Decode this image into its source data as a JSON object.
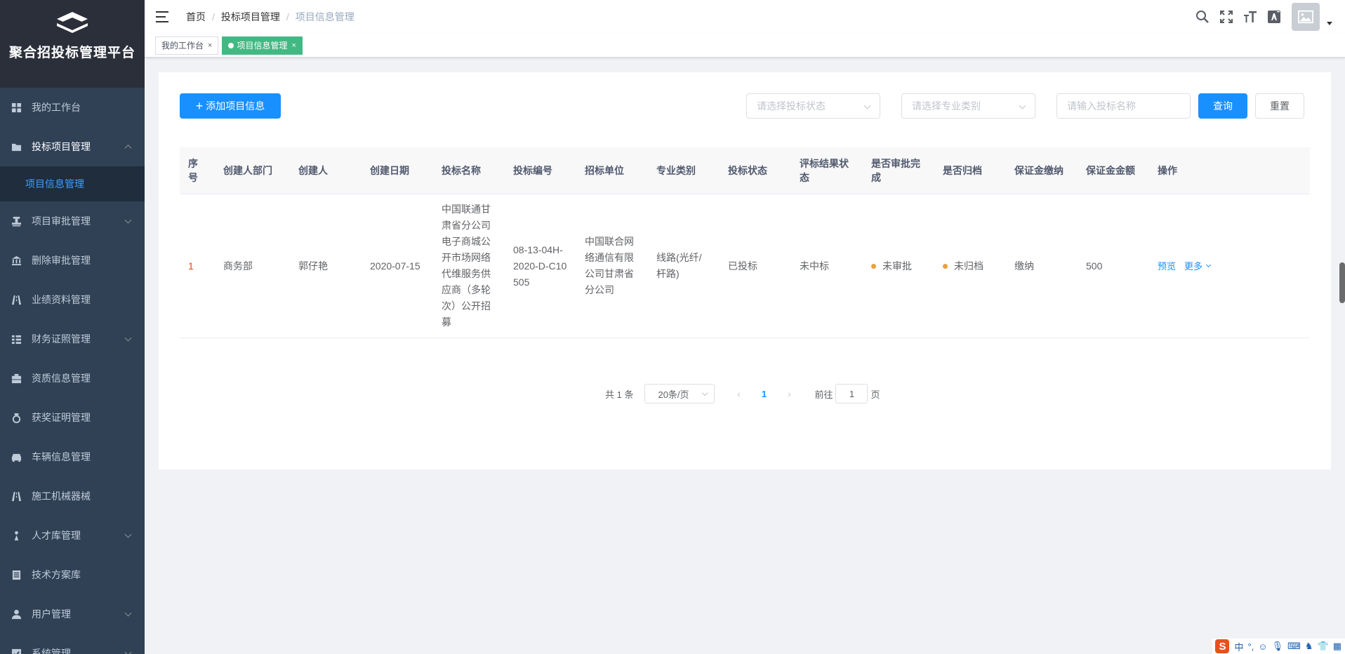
{
  "app": {
    "title": "聚合招投标管理平台"
  },
  "sidebar": {
    "items": [
      {
        "label": "我的工作台",
        "icon": "dashboard-icon",
        "expandable": false
      },
      {
        "label": "投标项目管理",
        "icon": "folder-icon",
        "expandable": true,
        "expanded": true
      },
      {
        "label": "项目审批管理",
        "icon": "stamp-icon",
        "expandable": true
      },
      {
        "label": "删除审批管理",
        "icon": "bank-icon",
        "expandable": false
      },
      {
        "label": "业绩资料管理",
        "icon": "road-icon",
        "expandable": false
      },
      {
        "label": "财务证照管理",
        "icon": "list-icon",
        "expandable": true
      },
      {
        "label": "资质信息管理",
        "icon": "briefcase-icon",
        "expandable": false
      },
      {
        "label": "获奖证明管理",
        "icon": "medal-icon",
        "expandable": false
      },
      {
        "label": "车辆信息管理",
        "icon": "car-icon",
        "expandable": false
      },
      {
        "label": "施工机械器械",
        "icon": "road-icon",
        "expandable": false
      },
      {
        "label": "人才库管理",
        "icon": "person-tie-icon",
        "expandable": true
      },
      {
        "label": "技术方案库",
        "icon": "document-icon",
        "expandable": false
      },
      {
        "label": "用户管理",
        "icon": "user-icon",
        "expandable": true
      },
      {
        "label": "系统管理",
        "icon": "check-box-icon",
        "expandable": true
      }
    ],
    "submenu": {
      "label": "项目信息管理"
    }
  },
  "header": {
    "breadcrumb": [
      "首页",
      "投标项目管理",
      "项目信息管理"
    ],
    "breadcrumb_sep": "/"
  },
  "tags": [
    {
      "label": "我的工作台",
      "close": "×",
      "active": false
    },
    {
      "label": "项目信息管理",
      "close": "×",
      "active": true
    }
  ],
  "toolbar": {
    "add_label": "添加项目信息",
    "add_plus": "+",
    "status_placeholder": "请选择投标状态",
    "category_placeholder": "请选择专业类别",
    "name_placeholder": "请输入投标名称",
    "query_label": "查询",
    "reset_label": "重置"
  },
  "table": {
    "columns": [
      "序号",
      "创建人部门",
      "创建人",
      "创建日期",
      "投标名称",
      "投标编号",
      "招标单位",
      "专业类别",
      "投标状态",
      "评标结果状态",
      "是否审批完成",
      "是否归档",
      "保证金缴纳",
      "保证金金额",
      "操作"
    ],
    "rows": [
      {
        "index": "1",
        "dept": "商务部",
        "creator": "郭仔艳",
        "date": "2020-07-15",
        "name": "中国联通甘肃省分公司电子商城公开市场网络代维服务供应商（多轮次）公开招募",
        "code": "08-13-04H-2020-D-C10505",
        "tenderer": "中国联合网络通信有限公司甘肃省分公司",
        "category": "线路(光纤/杆路)",
        "bid_status": "已投标",
        "result_status": "未中标",
        "approved": "未审批",
        "archived": "未归档",
        "deposit_paid": "缴纳",
        "deposit_amount": "500",
        "op_preview": "预览",
        "op_more": "更多"
      }
    ]
  },
  "pagination": {
    "total_text": "共 1 条",
    "page_size": "20条/页",
    "prev": "‹",
    "current": "1",
    "next": "›",
    "goto_prefix": "前往",
    "goto_value": "1",
    "goto_suffix": "页"
  },
  "ime": {
    "logo": "S",
    "lang": "中",
    "punct": "°,"
  },
  "colors": {
    "sidebar_bg": "#304156",
    "logo_bg": "#2b2f3a",
    "primary": "#1890ff",
    "tag_active": "#42b983",
    "warning_dot": "#e6a23c"
  }
}
